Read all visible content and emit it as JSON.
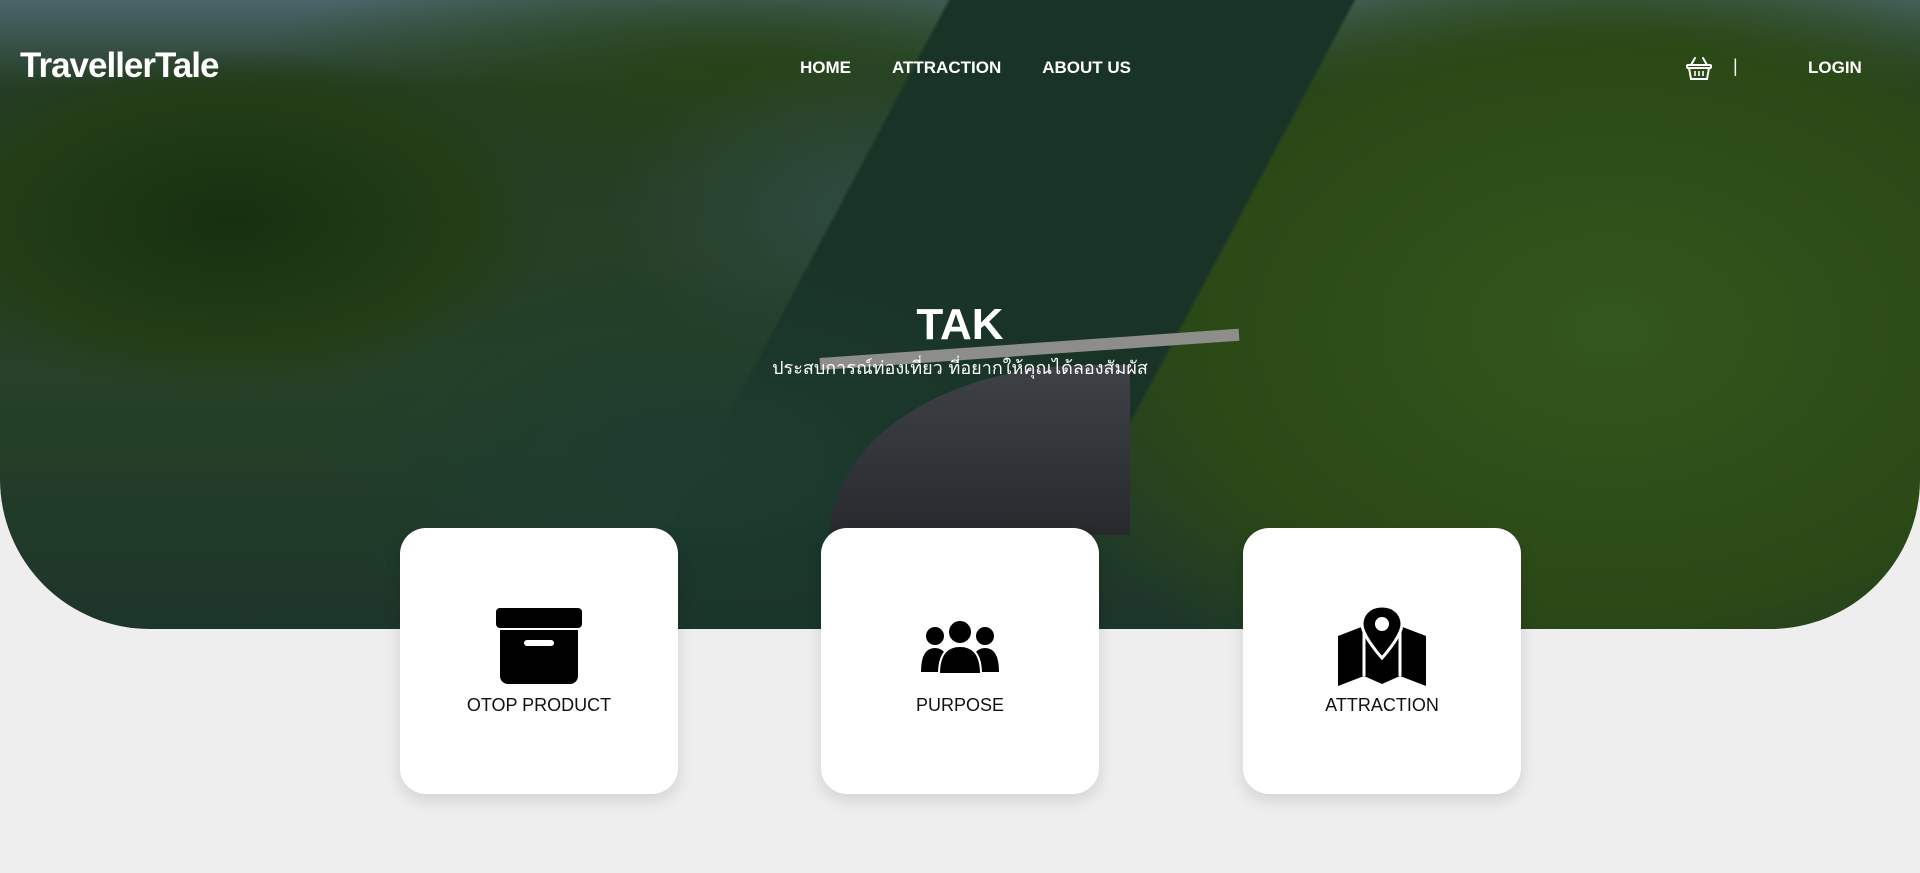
{
  "header": {
    "logo": "TravellerTale",
    "nav": [
      {
        "label": "HOME"
      },
      {
        "label": "ATTRACTION"
      },
      {
        "label": "ABOUT US"
      }
    ],
    "divider": "|",
    "login_label": "LOGIN",
    "basket_icon": "basket-icon"
  },
  "hero": {
    "title": "TAK",
    "subtitle": "ประสบการณ์ท่องเที่ยว ที่อยากให้คุณได้ลองสัมผัส"
  },
  "cards": [
    {
      "label": "OTOP PRODUCT",
      "icon": "archive-box-icon"
    },
    {
      "label": "PURPOSE",
      "icon": "users-group-icon"
    },
    {
      "label": "ATTRACTION",
      "icon": "map-pin-icon"
    }
  ],
  "colors": {
    "page_background": "#eeeeee",
    "card_background": "#ffffff",
    "header_text": "#ffffff",
    "card_text": "#111111"
  }
}
